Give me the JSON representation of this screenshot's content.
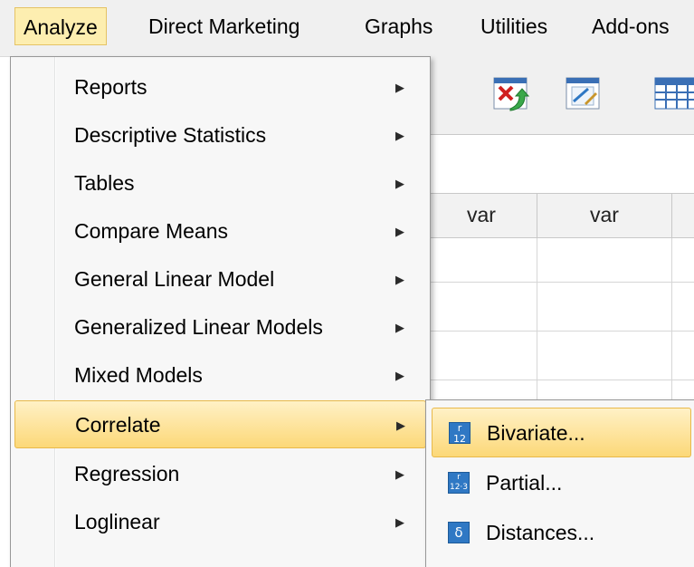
{
  "menubar": {
    "items": [
      {
        "label": "Analyze"
      },
      {
        "label": "Direct Marketing"
      },
      {
        "label": "Graphs"
      },
      {
        "label": "Utilities"
      },
      {
        "label": "Add-ons"
      }
    ]
  },
  "grid": {
    "columns": [
      "var",
      "var"
    ]
  },
  "analyze_menu": {
    "items": [
      {
        "label": "Reports"
      },
      {
        "label": "Descriptive Statistics"
      },
      {
        "label": "Tables"
      },
      {
        "label": "Compare Means"
      },
      {
        "label": "General Linear Model"
      },
      {
        "label": "Generalized Linear Models"
      },
      {
        "label": "Mixed Models"
      },
      {
        "label": "Correlate"
      },
      {
        "label": "Regression"
      },
      {
        "label": "Loglinear"
      }
    ]
  },
  "correlate_submenu": {
    "items": [
      {
        "label": "Bivariate...",
        "icon": "bivariate-icon"
      },
      {
        "label": "Partial...",
        "icon": "partial-icon"
      },
      {
        "label": "Distances...",
        "icon": "distances-icon"
      }
    ]
  },
  "colors": {
    "highlight": "#fcd878",
    "menu_background": "#f7f7f7",
    "icon_blue": "#2f78c4"
  }
}
